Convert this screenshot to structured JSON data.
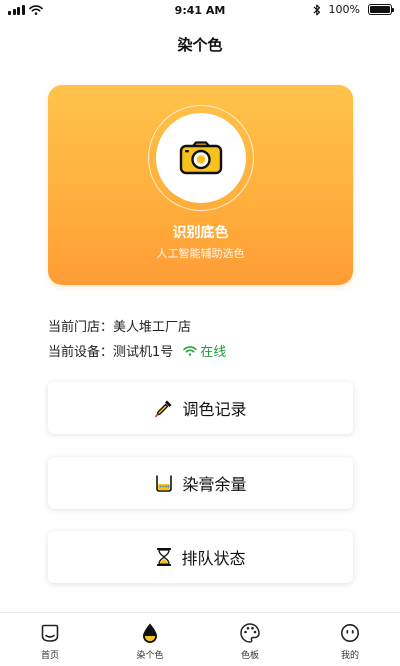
{
  "status_bar": {
    "time": "9:41 AM",
    "battery": "100%"
  },
  "nav": {
    "title": "染个色"
  },
  "hero": {
    "title": "识别底色",
    "subtitle": "人工智能辅助选色",
    "icon": "camera-icon"
  },
  "info": {
    "store_label": "当前门店：",
    "store_value": "美人堆工厂店",
    "device_label": "当前设备：",
    "device_value": "测试机1号",
    "device_status": "在线"
  },
  "actions": [
    {
      "label": "调色记录",
      "icon": "dropper-icon"
    },
    {
      "label": "染膏余量",
      "icon": "container-icon"
    },
    {
      "label": "排队状态",
      "icon": "hourglass-icon"
    }
  ],
  "tabs": [
    {
      "label": "首页",
      "icon": "home-icon"
    },
    {
      "label": "染个色",
      "icon": "drop-icon",
      "active": true
    },
    {
      "label": "色板",
      "icon": "palette-icon"
    },
    {
      "label": "我的",
      "icon": "profile-icon"
    }
  ],
  "colors": {
    "accent": "#ffae3c",
    "online": "#1aa33a",
    "icon_yellow": "#f7c21b"
  }
}
